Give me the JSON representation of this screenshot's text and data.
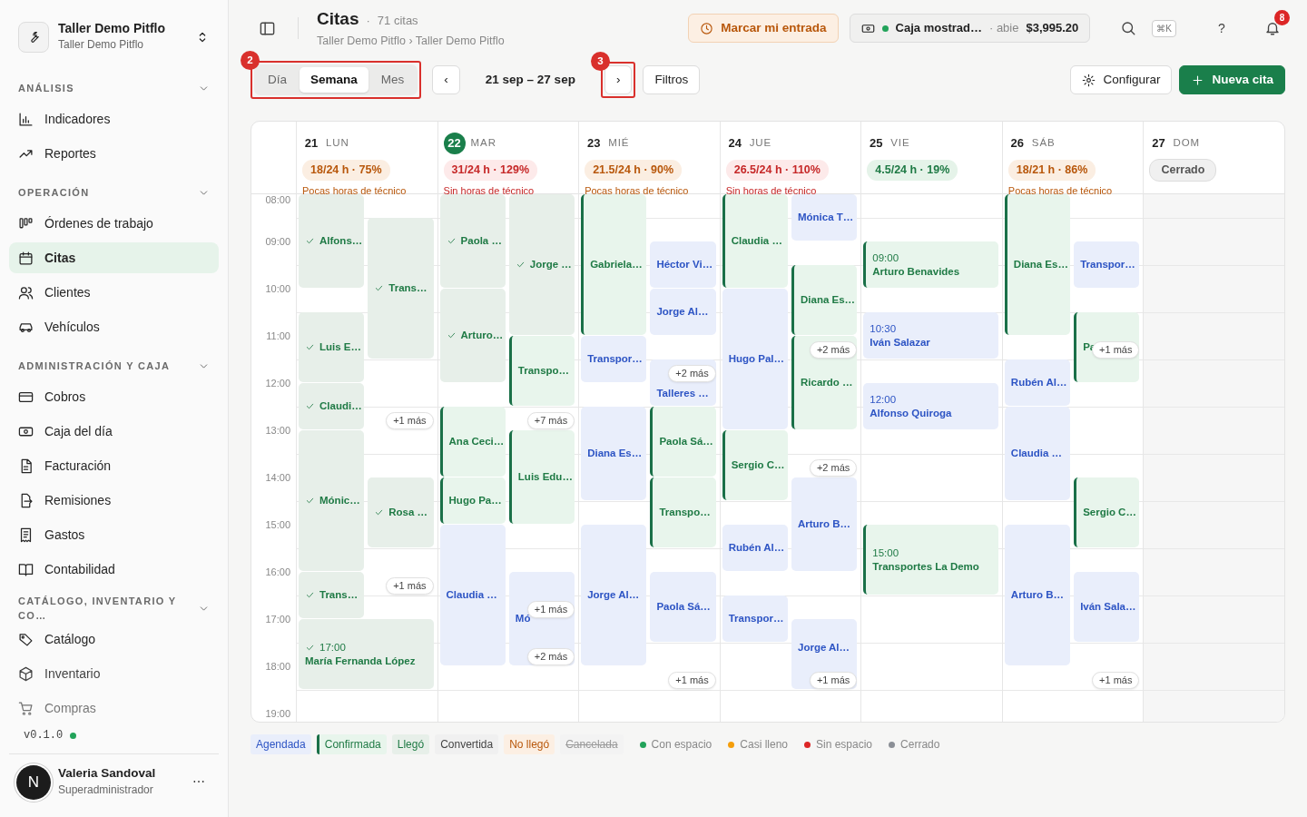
{
  "sidebar": {
    "workspace": {
      "name": "Taller Demo Pitflo",
      "subtitle": "Taller Demo Pitflo"
    },
    "sections": [
      {
        "title": "ANÁLISIS",
        "expanded": true,
        "items": [
          {
            "label": "Indicadores",
            "selected": false
          },
          {
            "label": "Reportes",
            "selected": false
          }
        ]
      },
      {
        "title": "OPERACIÓN",
        "expanded": true,
        "items": [
          {
            "label": "Órdenes de trabajo",
            "selected": false
          },
          {
            "label": "Citas",
            "selected": true
          },
          {
            "label": "Clientes",
            "selected": false
          },
          {
            "label": "Vehículos",
            "selected": false
          }
        ]
      },
      {
        "title": "ADMINISTRACIÓN Y CAJA",
        "expanded": true,
        "items": [
          {
            "label": "Cobros",
            "selected": false
          },
          {
            "label": "Caja del día",
            "selected": false
          },
          {
            "label": "Facturación",
            "selected": false
          },
          {
            "label": "Remisiones",
            "selected": false
          },
          {
            "label": "Gastos",
            "selected": false
          },
          {
            "label": "Contabilidad",
            "selected": false
          }
        ]
      },
      {
        "title": "CATÁLOGO, INVENTARIO Y CO…",
        "expanded": true,
        "items": [
          {
            "label": "Catálogo",
            "selected": false
          },
          {
            "label": "Inventario",
            "selected": false
          },
          {
            "label": "Compras",
            "selected": false
          }
        ]
      }
    ],
    "version": "v0.1.0",
    "user": {
      "initial": "N",
      "name": "Valeria Sandoval",
      "role": "Superadministrador",
      "menu": "⋯"
    }
  },
  "header": {
    "title": "Citas",
    "separator": "·",
    "count": "71 citas",
    "breadcrumb": "Taller Demo Pitflo › Taller Demo Pitflo",
    "check_in": "Marcar mi entrada",
    "cash": {
      "name": "Caja mostrad…",
      "separator": "·",
      "state": "abie",
      "amount": "$3,995.20"
    },
    "shortcut": "⌘K",
    "help": "?",
    "notifications": "8"
  },
  "toolbar": {
    "views": [
      {
        "label": "Día",
        "selected": false
      },
      {
        "label": "Semana",
        "selected": true
      },
      {
        "label": "Mes",
        "selected": false
      }
    ],
    "views_marker": "2",
    "prev": "‹",
    "range": "21 sep – 27 sep",
    "next": "›",
    "next_marker": "3",
    "filters": "Filtros",
    "configure": "Configurar",
    "new": "Nueva cita"
  },
  "hours": [
    "08:00",
    "09:00",
    "10:00",
    "11:00",
    "12:00",
    "13:00",
    "14:00",
    "15:00",
    "16:00",
    "17:00",
    "18:00",
    "19:00"
  ],
  "days": [
    {
      "number": "21",
      "weekday": "LUN",
      "today": false,
      "load": "18/24 h · 75%",
      "kind": "warn",
      "note": "Pocas horas de técnico",
      "events": [
        {
          "name": "Alfons…",
          "kind": "llego"
        },
        {
          "name": "Trans…",
          "kind": "llego"
        },
        {
          "name": "Luis E…",
          "kind": "llego"
        },
        {
          "name": "Claudi…",
          "kind": "llego"
        },
        {
          "name": "Mónic…",
          "kind": "llego"
        },
        {
          "name": "Rosa …",
          "kind": "llego"
        },
        {
          "name": "Trans…",
          "kind": "llego"
        },
        {
          "name": "María Fernanda López",
          "time": "17:00",
          "kind": "llego"
        }
      ],
      "more": [
        "+1 más",
        "+1 más"
      ]
    },
    {
      "number": "22",
      "weekday": "MAR",
      "today": true,
      "load": "31/24 h · 129%",
      "kind": "full",
      "note": "Sin horas de técnico",
      "events": [
        {
          "name": "Paola …",
          "kind": "llego"
        },
        {
          "name": "Jorge …",
          "kind": "llego"
        },
        {
          "name": "Arturo…",
          "kind": "llego"
        },
        {
          "name": "Transpo…",
          "kind": "confirmada"
        },
        {
          "name": "Ana Ceci…",
          "kind": "confirmada"
        },
        {
          "name": "Luis Edu…",
          "kind": "confirmada"
        },
        {
          "name": "Hugo Pa…",
          "kind": "confirmada"
        },
        {
          "name": "Claudia …",
          "kind": "agendada"
        },
        {
          "name": "Mó",
          "kind": "agendada"
        }
      ],
      "more": [
        "+7 más",
        "+1 más",
        "+2 más"
      ]
    },
    {
      "number": "23",
      "weekday": "MIÉ",
      "today": false,
      "load": "21.5/24 h · 90%",
      "kind": "warn",
      "note": "Pocas horas de técnico",
      "events": [
        {
          "name": "Gabriela…",
          "kind": "confirmada"
        },
        {
          "name": "Héctor Vi…",
          "kind": "agendada"
        },
        {
          "name": "Jorge Al…",
          "kind": "agendada"
        },
        {
          "name": "Transpor…",
          "kind": "agendada"
        },
        {
          "name": "Talleres …",
          "kind": "agendada"
        },
        {
          "name": "Paola Sá…",
          "kind": "confirmada"
        },
        {
          "name": "Diana Es…",
          "kind": "agendada"
        },
        {
          "name": "Transpo…",
          "kind": "confirmada"
        },
        {
          "name": "Jorge Al…",
          "kind": "agendada"
        },
        {
          "name": "Paola Sá…",
          "kind": "agendada"
        }
      ],
      "more": [
        "+2 más",
        "+1 más"
      ]
    },
    {
      "number": "24",
      "weekday": "JUE",
      "today": false,
      "load": "26.5/24 h · 110%",
      "kind": "full",
      "note": "Sin horas de técnico",
      "events": [
        {
          "name": "Claudia …",
          "kind": "confirmada"
        },
        {
          "name": "Mónica T…",
          "kind": "agendada"
        },
        {
          "name": "Diana Es…",
          "kind": "confirmada"
        },
        {
          "name": "Hugo Pal…",
          "kind": "agendada"
        },
        {
          "name": "Ricardo …",
          "kind": "confirmada"
        },
        {
          "name": "Sergio C…",
          "kind": "confirmada"
        },
        {
          "name": "Arturo B…",
          "kind": "agendada"
        },
        {
          "name": "Rubén Al…",
          "kind": "agendada"
        },
        {
          "name": "Transpor…",
          "kind": "agendada"
        },
        {
          "name": "Jorge Al…",
          "kind": "agendada"
        }
      ],
      "more": [
        "+2 más",
        "+2 más",
        "+1 más"
      ]
    },
    {
      "number": "25",
      "weekday": "VIE",
      "today": false,
      "load": "4.5/24 h · 19%",
      "kind": "ok",
      "events": [
        {
          "name": "Arturo Benavides",
          "time": "09:00",
          "kind": "confirmada"
        },
        {
          "name": "Iván Salazar",
          "time": "10:30",
          "kind": "agendada"
        },
        {
          "name": "Alfonso Quiroga",
          "time": "12:00",
          "kind": "agendada"
        },
        {
          "name": "Transportes La Demo",
          "time": "15:00",
          "kind": "confirmada"
        }
      ]
    },
    {
      "number": "26",
      "weekday": "SÁB",
      "today": false,
      "load": "18/21 h · 86%",
      "kind": "warn",
      "note": "Pocas horas de técnico",
      "events": [
        {
          "name": "Diana Es…",
          "kind": "confirmada"
        },
        {
          "name": "Transpor…",
          "kind": "agendada"
        },
        {
          "name": "Pa",
          "kind": "confirmada"
        },
        {
          "name": "Rubén Al…",
          "kind": "agendada"
        },
        {
          "name": "Claudia …",
          "kind": "agendada"
        },
        {
          "name": "Sergio C…",
          "kind": "confirmada"
        },
        {
          "name": "Arturo B…",
          "kind": "agendada"
        },
        {
          "name": "Iván Sala…",
          "kind": "agendada"
        }
      ],
      "more": [
        "+1 más",
        "+1 más"
      ]
    },
    {
      "number": "27",
      "weekday": "DOM",
      "today": false,
      "load": "Cerrado",
      "kind": "closed"
    }
  ],
  "legend": {
    "statuses": [
      {
        "label": "Agendada",
        "kind": "agendada"
      },
      {
        "label": "Confirmada",
        "kind": "confirmada"
      },
      {
        "label": "Llegó",
        "kind": "llego"
      },
      {
        "label": "Convertida",
        "kind": "convertida"
      },
      {
        "label": "No llegó",
        "kind": "no_llego"
      },
      {
        "label": "Cancelada",
        "kind": "cancelada"
      }
    ],
    "capacity": [
      {
        "label": "Con espacio",
        "color": "#22a35a"
      },
      {
        "label": "Casi lleno",
        "color": "#f59e0b"
      },
      {
        "label": "Sin espacio",
        "color": "#dc2626"
      },
      {
        "label": "Cerrado",
        "color": "#8b8f96"
      }
    ]
  }
}
